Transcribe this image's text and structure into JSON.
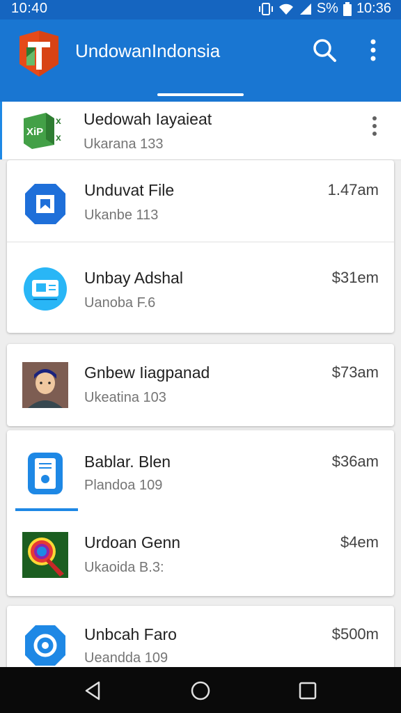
{
  "status_bar": {
    "time": "10:40",
    "battery": "S%",
    "clock_right": "10:36"
  },
  "app_bar": {
    "title": "UndowanIndonsia",
    "logo_icon": "app-logo",
    "search_icon": "search-icon",
    "menu_icon": "more-vert-icon"
  },
  "items": [
    {
      "title": "Uedowah Iayaieat",
      "subtitle": "Ukarana 133",
      "time": "",
      "icon": "spreadsheet-icon"
    },
    {
      "title": "Unduvat File",
      "subtitle": "Ukanbe 113",
      "time": "1.47am",
      "icon": "bookmark-icon"
    },
    {
      "title": "Unbay Adshal",
      "subtitle": "Uanoba F.6",
      "time": "$31em",
      "icon": "card-icon"
    },
    {
      "title": "Gnbew Iiagpanad",
      "subtitle": "Ukeatina 103",
      "time": "$73am",
      "icon": "avatar"
    },
    {
      "title": "Bablar. Blen",
      "subtitle": "Plandoa 109",
      "time": "$36am",
      "icon": "file-icon"
    },
    {
      "title": "Urdoan Genn",
      "subtitle": "Ukaoida B.3:",
      "time": "$4em",
      "icon": "magnifier-icon"
    },
    {
      "title": "Unbcah Faro",
      "subtitle": "Ueandda 109",
      "time": "$500m",
      "icon": "settings-icon"
    }
  ],
  "colors": {
    "primary": "#1976d2",
    "status_bar": "#1565c0",
    "accent": "#1e88e5"
  }
}
